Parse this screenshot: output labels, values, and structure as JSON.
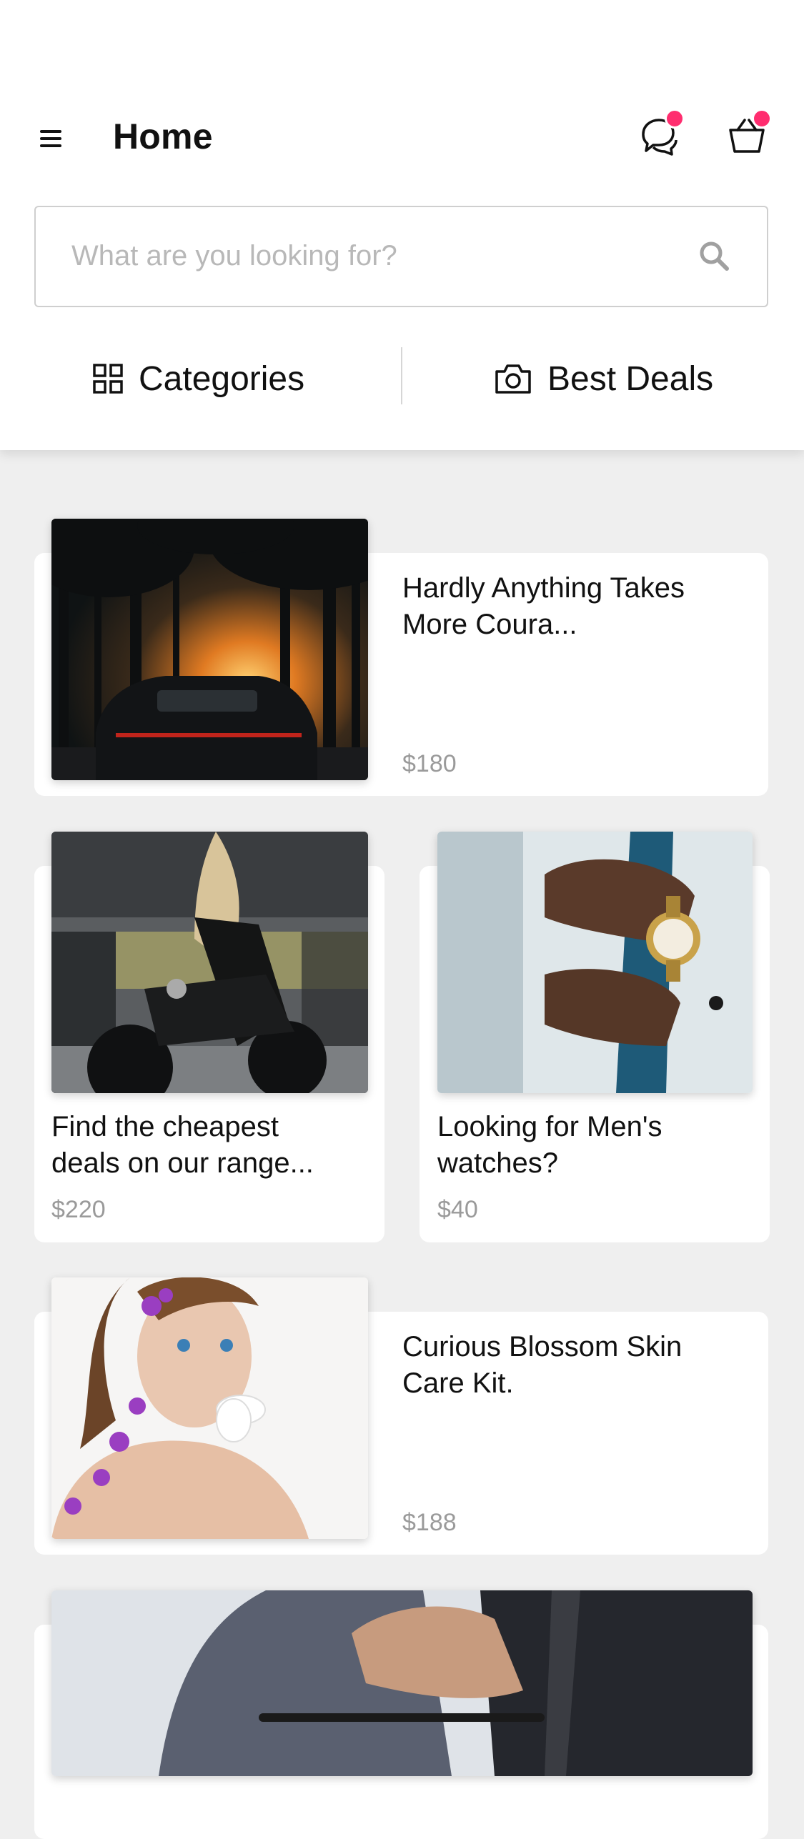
{
  "header": {
    "title": "Home",
    "chat_badge_color": "#ff2d6f",
    "cart_badge_color": "#ff2d6f"
  },
  "search": {
    "placeholder": "What are you looking for?",
    "icon": "search-icon"
  },
  "tabs": [
    {
      "label": "Categories",
      "icon": "grid-icon"
    },
    {
      "label": "Best Deals",
      "icon": "camera-icon"
    }
  ],
  "products": [
    {
      "title_line1": "Hardly Anything Takes",
      "title_line2": "More Coura...",
      "price": "$180",
      "image": "sports-car-sunset-image"
    },
    {
      "title_line1": "Find the cheapest",
      "title_line2": "deals on our range...",
      "price": "$220",
      "image": "woman-on-motorcycle-image"
    },
    {
      "title_line1": "Looking for Men's",
      "title_line2": "watches?",
      "price": "$40",
      "image": "mens-watch-image"
    },
    {
      "title_line1": "Curious Blossom Skin",
      "title_line2": "Care Kit.",
      "price": "$188",
      "image": "woman-with-flowers-image"
    },
    {
      "image": "suit-closeup-image"
    }
  ]
}
